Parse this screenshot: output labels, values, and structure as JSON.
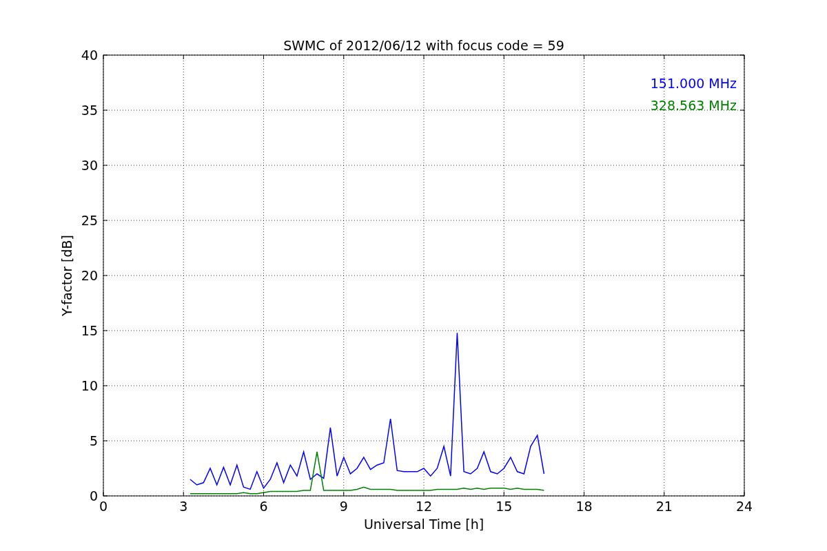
{
  "chart_data": {
    "type": "line",
    "title": "SWMC of 2012/06/12 with focus code = 59",
    "xlabel": "Universal Time [h]",
    "ylabel": "Y-factor [dB]",
    "x": [
      3.25,
      3.5,
      3.75,
      4.0,
      4.25,
      4.5,
      4.75,
      5.0,
      5.25,
      5.5,
      5.75,
      6.0,
      6.25,
      6.5,
      6.75,
      7.0,
      7.25,
      7.5,
      7.75,
      8.0,
      8.25,
      8.5,
      8.75,
      9.0,
      9.25,
      9.5,
      9.75,
      10.0,
      10.25,
      10.5,
      10.75,
      11.0,
      11.25,
      11.5,
      11.75,
      12.0,
      12.25,
      12.5,
      12.75,
      13.0,
      13.25,
      13.5,
      13.75,
      14.0,
      14.25,
      14.5,
      14.75,
      15.0,
      15.25,
      15.5,
      15.75,
      16.0,
      16.25,
      16.5
    ],
    "series": [
      {
        "name": "151.000 MHz",
        "color": "#0000ff",
        "values": [
          1.5,
          1.0,
          1.2,
          2.5,
          1.0,
          2.6,
          1.0,
          2.8,
          0.8,
          0.6,
          2.2,
          0.7,
          1.5,
          3.0,
          1.2,
          2.8,
          1.8,
          4.0,
          1.5,
          2.0,
          1.6,
          6.2,
          1.8,
          3.5,
          2.0,
          2.5,
          3.5,
          2.4,
          2.8,
          3.0,
          7.0,
          2.3,
          2.2,
          2.2,
          2.2,
          2.5,
          1.8,
          2.5,
          4.5,
          1.8,
          14.8,
          2.2,
          2.0,
          2.5,
          4.0,
          2.2,
          2.0,
          2.5,
          3.5,
          2.2,
          2.0,
          4.5,
          5.5,
          2.0
        ]
      },
      {
        "name": "328.563 MHz",
        "color": "#008000",
        "values": [
          0.2,
          0.2,
          0.2,
          0.2,
          0.2,
          0.2,
          0.2,
          0.2,
          0.3,
          0.2,
          0.2,
          0.3,
          0.4,
          0.4,
          0.4,
          0.4,
          0.4,
          0.5,
          0.5,
          4.0,
          0.5,
          0.5,
          0.5,
          0.5,
          0.5,
          0.6,
          0.8,
          0.6,
          0.6,
          0.6,
          0.6,
          0.5,
          0.5,
          0.5,
          0.5,
          0.5,
          0.5,
          0.6,
          0.6,
          0.6,
          0.6,
          0.7,
          0.6,
          0.7,
          0.6,
          0.7,
          0.7,
          0.7,
          0.6,
          0.7,
          0.6,
          0.6,
          0.6,
          0.5
        ]
      }
    ],
    "xlim": [
      0,
      24
    ],
    "ylim": [
      0,
      40
    ],
    "xticks": [
      0,
      3,
      6,
      9,
      12,
      15,
      18,
      21,
      24
    ],
    "yticks": [
      0,
      5,
      10,
      15,
      20,
      25,
      30,
      35,
      40
    ],
    "grid": true
  }
}
